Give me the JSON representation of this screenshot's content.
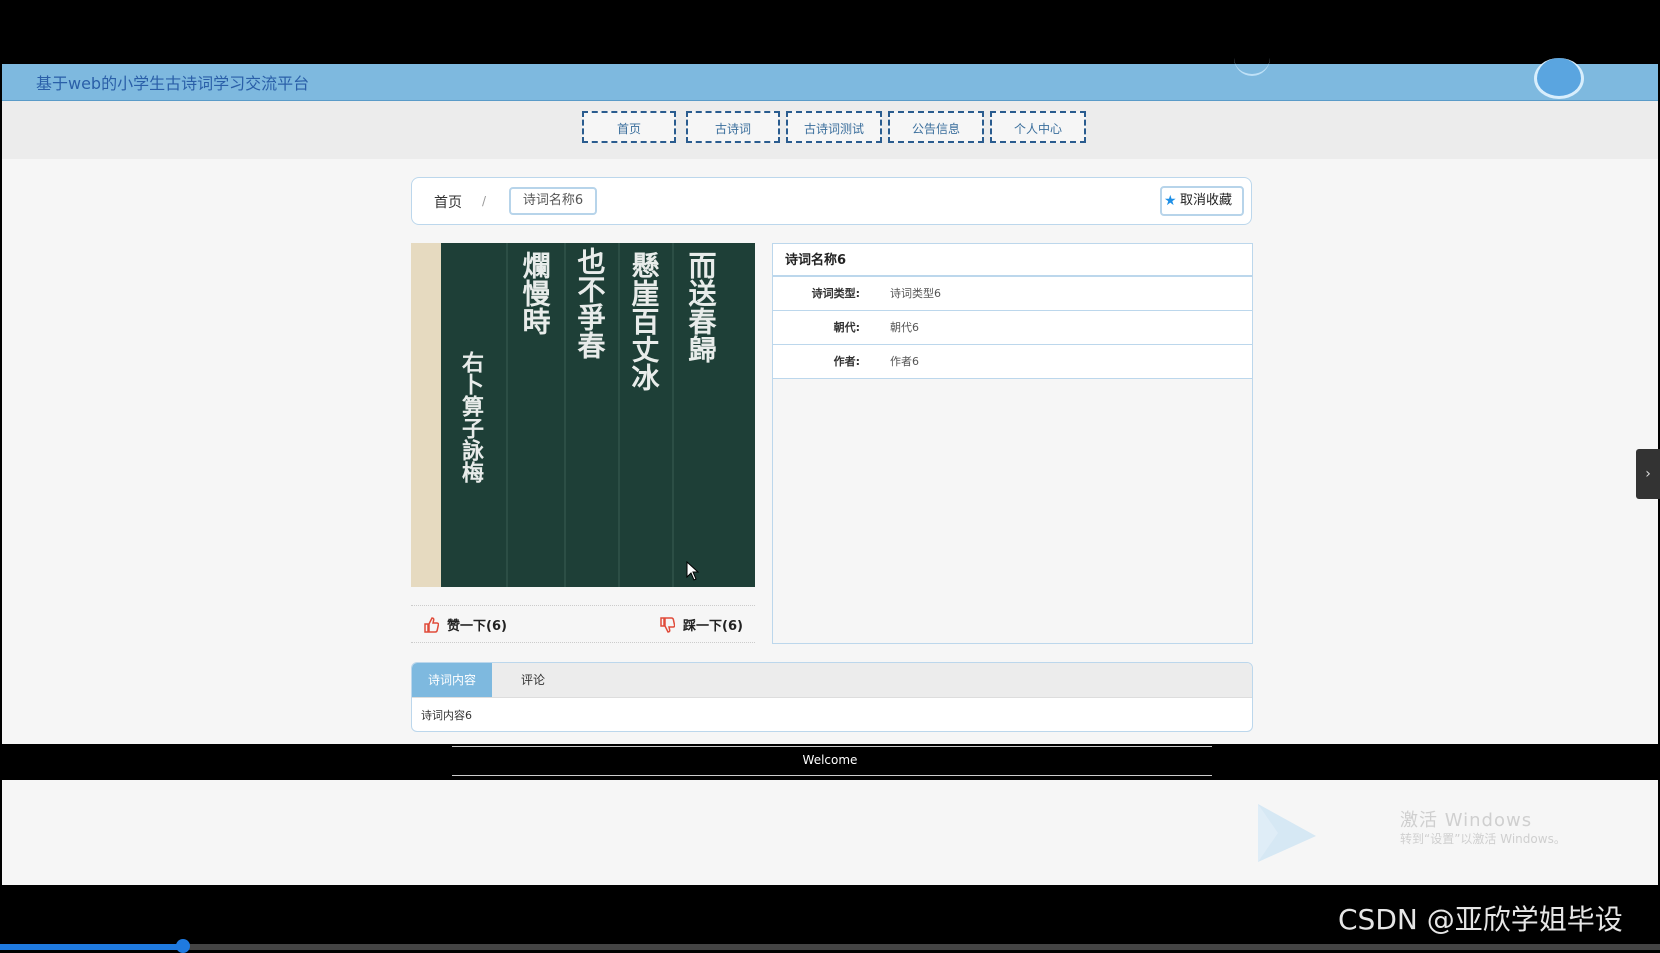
{
  "header": {
    "site_title": "基于web的小学生古诗词学习交流平台"
  },
  "nav": {
    "items": [
      {
        "label": "首页"
      },
      {
        "label": "古诗词"
      },
      {
        "label": "古诗词测试"
      },
      {
        "label": "公告信息"
      },
      {
        "label": "个人中心"
      }
    ]
  },
  "breadcrumb": {
    "home": "首页",
    "separator": "/",
    "current": "诗词名称6"
  },
  "favorite": {
    "label": "取消收藏",
    "icon": "star-icon"
  },
  "image": {
    "text_cols": [
      "而送春歸",
      "懸崖百丈冰",
      "也不爭春",
      "爛慢時",
      "右卜算子詠梅"
    ]
  },
  "votes": {
    "like_label": "赞一下(6)",
    "dislike_label": "踩一下(6)"
  },
  "details": {
    "title": "诗词名称6",
    "rows": [
      {
        "label": "诗词类型:",
        "value": "诗词类型6"
      },
      {
        "label": "朝代:",
        "value": "朝代6"
      },
      {
        "label": "作者:",
        "value": "作者6"
      }
    ]
  },
  "tabs": {
    "items": [
      {
        "label": "诗词内容"
      },
      {
        "label": "评论"
      }
    ],
    "content": "诗词内容6"
  },
  "footer": {
    "text": "Welcome"
  },
  "windows_watermark": {
    "line1": "激活 Windows",
    "line2": "转到“设置”以激活 Windows。"
  },
  "csdn_watermark": "CSDN @亚欣学姐毕设",
  "colors": {
    "header": "#7eb9df",
    "accent": "#1e8fe6",
    "nav_border": "#2a5c8f",
    "tab_active": "#7eb9df"
  }
}
